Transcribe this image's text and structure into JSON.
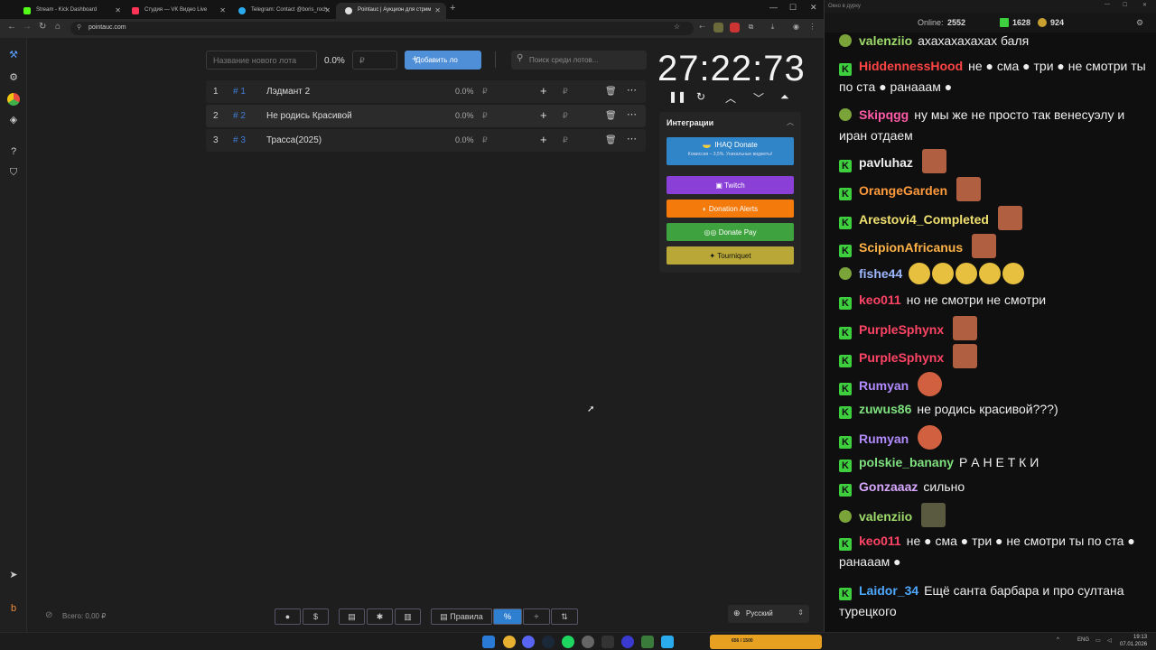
{
  "browser": {
    "tabs": [
      {
        "label": "Stream - Kick Dashboard",
        "color": "#53fc18"
      },
      {
        "label": "Студия — VK Видео Live",
        "color": "#ff3355"
      },
      {
        "label": "Telegram: Contact @boris_roch",
        "color": "#2aabee"
      },
      {
        "label": "Pointauc | Аукцион для стрим",
        "color": "#ffffff"
      }
    ],
    "url": "pointauc.com"
  },
  "sidebar": {
    "icons": [
      "hammer-icon",
      "gear-icon",
      "pie-chart-icon",
      "layers-icon",
      "help-icon",
      "shield-icon",
      "telegram-icon",
      "boosty-icon"
    ]
  },
  "lot_form": {
    "name_placeholder": "Название нового лота",
    "percent": "0.0%",
    "amount_placeholder": "₽",
    "add_label": "Добавить ло",
    "search_placeholder": "Поиск среди лотов..."
  },
  "lots": [
    {
      "index": "1",
      "id": "# 1",
      "name": "Лэдмант 2",
      "percent": "0.0%",
      "currency": "₽"
    },
    {
      "index": "2",
      "id": "# 2",
      "name": "Не родись Красивой",
      "percent": "0.0%",
      "currency": "₽"
    },
    {
      "index": "3",
      "id": "# 3",
      "name": "Трасса(2025)",
      "percent": "0.0%",
      "currency": "₽"
    }
  ],
  "timer": {
    "value": "27:22:73"
  },
  "integrations": {
    "title": "Интеграции",
    "ihaq": {
      "label": "IHAQ Donate",
      "sub": "Комиссия – 3,5%. Уникальные виджеты!"
    },
    "buttons": [
      {
        "label": "Twitch",
        "color": "#8a3fd6"
      },
      {
        "label": "Donation Alerts",
        "color": "#f47a0c"
      },
      {
        "label": "Donate Pay",
        "color": "#3ea33e"
      },
      {
        "label": "Tourniquet",
        "color": "#b9a838"
      }
    ]
  },
  "footer": {
    "total_label": "Всего: 0,00 ₽",
    "rules_label": "Правила",
    "language": "Русский"
  },
  "chat": {
    "window_title": "Окно в дурку",
    "online_label": "Online:",
    "online_count": "2552",
    "kick_count": "1628",
    "other_count": "924",
    "messages": [
      {
        "user": "valenziio",
        "color": "#9edb6a",
        "icon": "frog",
        "text": "ахахахахахах баля"
      },
      {
        "user": "HiddennessHood",
        "color": "#ff4444",
        "icon": "kick",
        "text": "не ● сма ● три ● не смотри ты по ста ● ранааам ●"
      },
      {
        "user": "Skipqgg",
        "color": "#ff5aa8",
        "icon": "frog",
        "text": "ну мы же не просто так венесуэлу и иран отдаем"
      },
      {
        "user": "pavluhaz",
        "color": "#eeeeee",
        "icon": "kick",
        "text": ""
      },
      {
        "user": "OrangeGarden",
        "color": "#ff9a3c",
        "icon": "kick",
        "text": ""
      },
      {
        "user": "Arestovi4_Completed",
        "color": "#f0e070",
        "icon": "kick",
        "text": ""
      },
      {
        "user": "ScipionAfricanus",
        "color": "#ffb347",
        "icon": "kick",
        "text": ""
      },
      {
        "user": "fishe44",
        "color": "#9eb8ff",
        "icon": "frog",
        "text": ""
      },
      {
        "user": "keo011",
        "color": "#ff4466",
        "icon": "kick",
        "text": "но не смотри не смотри"
      },
      {
        "user": "PurpleSphynx",
        "color": "#ff4466",
        "icon": "kick",
        "text": ""
      },
      {
        "user": "PurpleSphynx",
        "color": "#ff4466",
        "icon": "kick",
        "text": ""
      },
      {
        "user": "Rumyan",
        "color": "#b28cff",
        "icon": "kick",
        "text": ""
      },
      {
        "user": "zuwus86",
        "color": "#7ee07e",
        "icon": "kick",
        "text": "не родись красивой???)"
      },
      {
        "user": "Rumyan",
        "color": "#b28cff",
        "icon": "kick",
        "text": ""
      },
      {
        "user": "polskie_banany",
        "color": "#7ee07e",
        "icon": "kick",
        "text": "Р А Н Е Т К И"
      },
      {
        "user": "Gonzaaaz",
        "color": "#d8a8ff",
        "icon": "kick",
        "text": "сильно"
      },
      {
        "user": "valenziio",
        "color": "#9edb6a",
        "icon": "frog",
        "text": ""
      },
      {
        "user": "keo011",
        "color": "#ff4466",
        "icon": "kick",
        "text": "не ● сма ● три ● не смотри ты по ста ● ранааам ●"
      },
      {
        "user": "Laidor_34",
        "color": "#4fa8ff",
        "icon": "kick",
        "text": "Ещё санта барбара и про султана турецкого"
      }
    ]
  },
  "taskbar": {
    "meme_label": "656 / 1500",
    "lang": "ENG",
    "time": "19:13",
    "date": "07.01.2026"
  }
}
